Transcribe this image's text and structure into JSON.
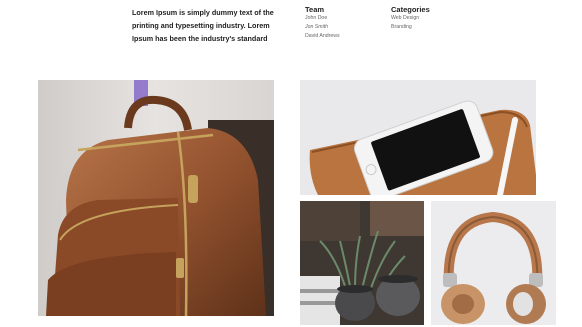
{
  "intro_text": "Lorem Ipsum is simply dummy text of the printing and typesetting industry. Lorem Ipsum has been the industry's standard",
  "team": {
    "title": "Team",
    "members": [
      "John Doe",
      "Jon Smith",
      "David Andrews"
    ]
  },
  "categories": {
    "title": "Categories",
    "items": [
      "Web Design",
      "Branding"
    ]
  },
  "gallery": [
    {
      "name": "leather-backpack-photo"
    },
    {
      "name": "phone-on-tablet-photo"
    },
    {
      "name": "plants-on-books-photo"
    },
    {
      "name": "headphones-photo"
    }
  ]
}
